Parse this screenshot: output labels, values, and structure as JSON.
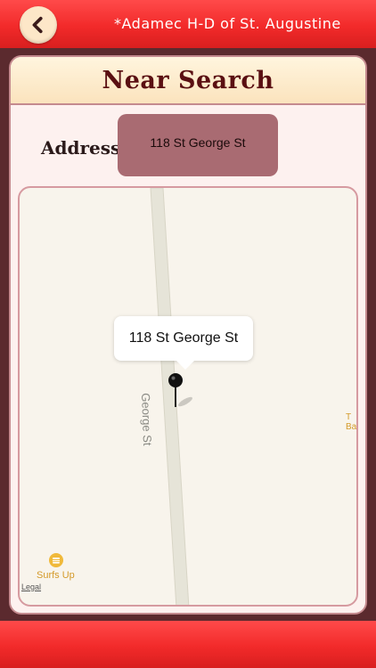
{
  "header": {
    "title": "*Adamec H-D of St. Augustine",
    "back_icon": "chevron-left-icon"
  },
  "card": {
    "title": "Near Search",
    "address_label": "Address",
    "address_value": "118 St George St"
  },
  "map": {
    "callout_text": "118 St George St",
    "street_name": "George St",
    "poi_name": "Surfs Up",
    "edge_label_line1": "T",
    "edge_label_line2": "Ba",
    "legal_link": "Legal"
  },
  "colors": {
    "bar_red": "#f22a2a",
    "title_maroon": "#5a0f12",
    "address_box": "#a96b72",
    "poi_amber": "#d49a2a"
  }
}
